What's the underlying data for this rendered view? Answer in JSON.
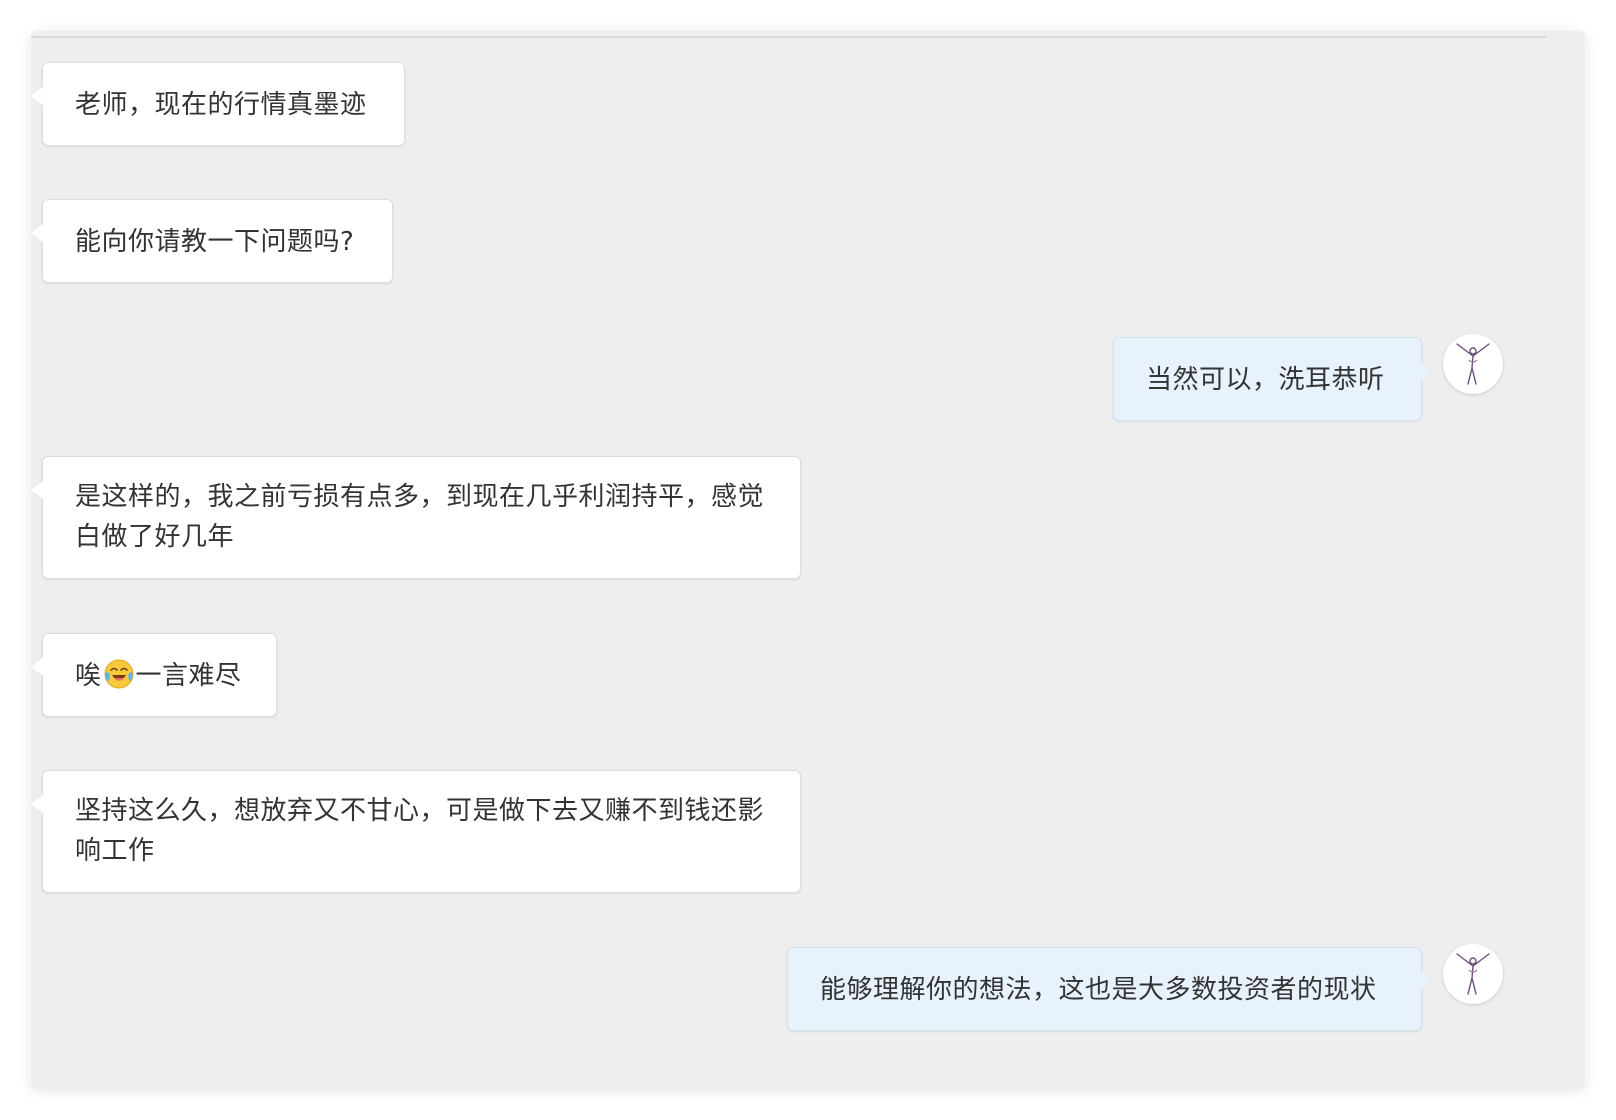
{
  "chat": {
    "messages": [
      {
        "side": "left",
        "text": "老师，现在的行情真墨迹"
      },
      {
        "side": "left",
        "text": "能向你请教一下问题吗?"
      },
      {
        "side": "right",
        "text": "当然可以，洗耳恭听"
      },
      {
        "side": "left",
        "text": "是这样的，我之前亏损有点多，到现在几乎利润持平，感觉白做了好几年"
      },
      {
        "side": "left",
        "text_before": "唉",
        "emoji": "laughing-crying-emoji",
        "text_after": "一言难尽"
      },
      {
        "side": "left",
        "text": "坚持这么久，想放弃又不甘心，可是做下去又赚不到钱还影响工作"
      },
      {
        "side": "right",
        "text": "能够理解你的想法，这也是大多数投资者的现状"
      }
    ]
  },
  "colors": {
    "panel_background": "#eeeeee",
    "incoming_bubble": "#ffffff",
    "outgoing_bubble": "#e8f2fc",
    "text": "#333333"
  },
  "icons": {
    "avatar": "dancer-figure-avatar"
  }
}
